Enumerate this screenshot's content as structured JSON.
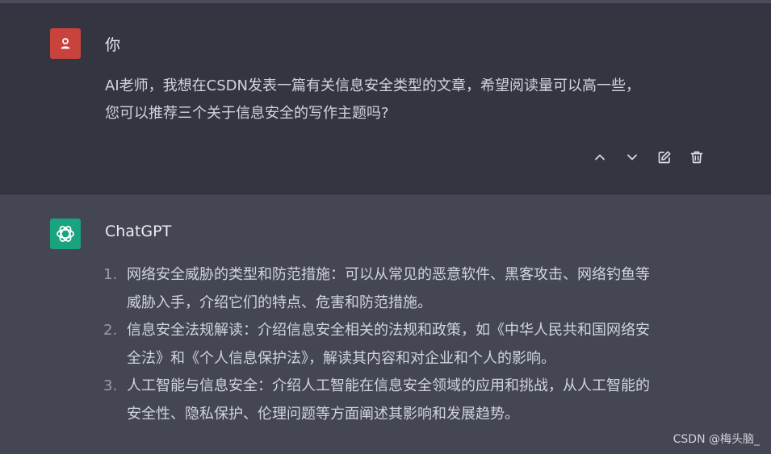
{
  "user_message": {
    "author": "你",
    "lines": [
      "AI老师，我想在CSDN发表一篇有关信息安全类型的文章，希望阅读量可以高一些，",
      "您可以推荐三个关于信息安全的写作主题吗?"
    ],
    "avatar_icon": "user-icon",
    "avatar_color": "#c8433c"
  },
  "actions": {
    "icons": [
      "chevron-up-icon",
      "chevron-down-icon",
      "edit-icon",
      "trash-icon"
    ]
  },
  "assistant_message": {
    "author": "ChatGPT",
    "avatar_icon": "openai-logo-icon",
    "avatar_color": "#19a37f",
    "items": [
      {
        "number": "1.",
        "lines": [
          "网络安全威胁的类型和防范措施：可以从常见的恶意软件、黑客攻击、网络钓鱼等",
          "威胁入手，介绍它们的特点、危害和防范措施。"
        ]
      },
      {
        "number": "2.",
        "lines": [
          "信息安全法规解读：介绍信息安全相关的法规和政策，如《中华人民共和国网络安",
          "全法》和《个人信息保护法》，解读其内容和对企业和个人的影响。"
        ]
      },
      {
        "number": "3.",
        "lines": [
          "人工智能与信息安全：介绍人工智能在信息安全领域的应用和挑战，从人工智能的",
          "安全性、隐私保护、伦理问题等方面阐述其影响和发展趋势。"
        ]
      }
    ]
  },
  "watermark": "CSDN @梅头脑_",
  "colors": {
    "user_bg": "#343541",
    "assistant_bg": "#444654",
    "text": "#d1d5db"
  }
}
